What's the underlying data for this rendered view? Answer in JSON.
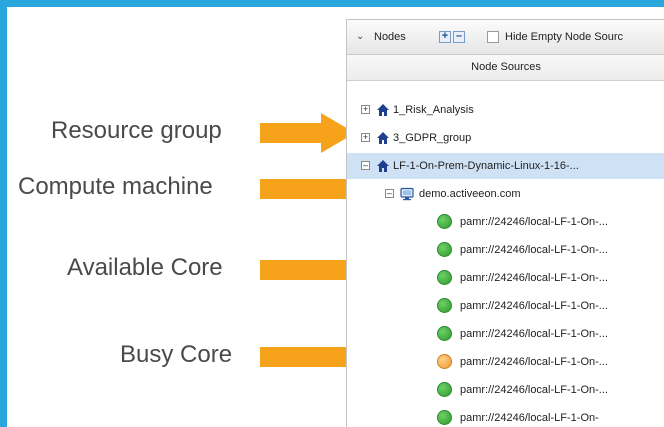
{
  "callouts": {
    "resource_group": "Resource group",
    "compute_machine": "Compute machine",
    "available_core": "Available Core",
    "busy_core": "Busy Core"
  },
  "colors": {
    "background": "#29a6dc",
    "arrow": "#f7a21b",
    "core_available": "#3aa83a",
    "core_busy": "#f5a742",
    "selected_row": "#cfe2f5"
  },
  "toolbar": {
    "collapse_icon": "chevron-down-icon",
    "nodes_label": "Nodes",
    "expand_all_icon": "plus-box-icon",
    "collapse_all_icon": "minus-box-icon",
    "hide_empty_label": "Hide Empty Node Sourc"
  },
  "column_header": "Node Sources",
  "tree": {
    "sources": [
      {
        "name": "1_Risk_Analysis",
        "state": "collapsed"
      },
      {
        "name": "3_GDPR_group",
        "state": "collapsed"
      },
      {
        "name": "LF-1-On-Prem-Dynamic-Linux-1-16-...",
        "state": "expanded"
      }
    ],
    "host": "demo.activeeon.com",
    "nodes": [
      {
        "label": "pamr://24246/local-LF-1-On-...",
        "status": "available"
      },
      {
        "label": "pamr://24246/local-LF-1-On-...",
        "status": "available"
      },
      {
        "label": "pamr://24246/local-LF-1-On-...",
        "status": "available"
      },
      {
        "label": "pamr://24246/local-LF-1-On-...",
        "status": "available"
      },
      {
        "label": "pamr://24246/local-LF-1-On-...",
        "status": "available"
      },
      {
        "label": "pamr://24246/local-LF-1-On-...",
        "status": "busy"
      },
      {
        "label": "pamr://24246/local-LF-1-On-...",
        "status": "available"
      },
      {
        "label": "pamr://24246/local-LF-1-On-",
        "status": "available"
      }
    ]
  }
}
